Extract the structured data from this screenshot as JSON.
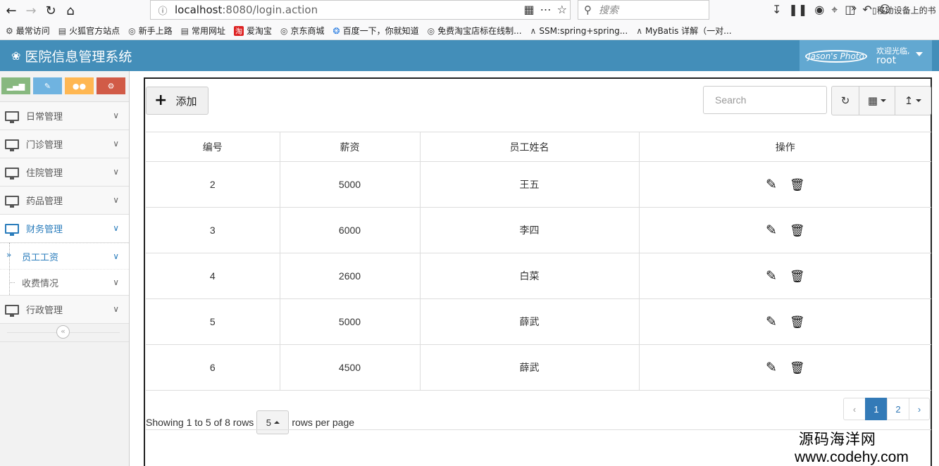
{
  "browser": {
    "url_host": "localhost",
    "url_rest": ":8080/login.action",
    "search_placeholder": "搜索",
    "bookmarks": [
      {
        "label": "最常访问",
        "icon": "gear-icon"
      },
      {
        "label": "火狐官方站点",
        "icon": "folder-icon"
      },
      {
        "label": "新手上路",
        "icon": "globe-icon"
      },
      {
        "label": "常用网址",
        "icon": "folder-icon"
      },
      {
        "label": "爱淘宝",
        "icon": "taobao-icon"
      },
      {
        "label": "京东商城",
        "icon": "globe-icon"
      },
      {
        "label": "百度一下，你就知道",
        "icon": "paw-icon"
      },
      {
        "label": "免费淘宝店标在线制...",
        "icon": "globe-icon"
      },
      {
        "label": "SSM:spring+spring...",
        "icon": "logo-icon"
      },
      {
        "label": "MyBatis 详解（一对...",
        "icon": "logo-icon"
      }
    ],
    "mobile_bookmarks": "移动设备上的书"
  },
  "header": {
    "brand": "医院信息管理系统",
    "photo_alt": "Jason's Photo",
    "welcome": "欢迎光临,",
    "username": "root"
  },
  "sidebar": {
    "menu": [
      {
        "label": "日常管理"
      },
      {
        "label": "门诊管理"
      },
      {
        "label": "住院管理"
      },
      {
        "label": "药品管理"
      },
      {
        "label": "财务管理"
      }
    ],
    "submenu": [
      {
        "label": "员工工资"
      },
      {
        "label": "收费情况"
      }
    ],
    "last_menu": {
      "label": "行政管理"
    }
  },
  "toolbar": {
    "add_label": "添加",
    "search_placeholder": "Search"
  },
  "table": {
    "columns": [
      "编号",
      "薪资",
      "员工姓名",
      "操作"
    ],
    "rows": [
      {
        "id": "2",
        "salary": "5000",
        "name": "王五"
      },
      {
        "id": "3",
        "salary": "6000",
        "name": "李四"
      },
      {
        "id": "4",
        "salary": "2600",
        "name": "白菜"
      },
      {
        "id": "5",
        "salary": "5000",
        "name": "薛武"
      },
      {
        "id": "6",
        "salary": "4500",
        "name": "薛武"
      }
    ]
  },
  "pager": {
    "showing": "Showing 1 to 5 of 8 rows",
    "page_size": "5",
    "per_page": "rows per page",
    "prev": "‹",
    "pages": [
      "1",
      "2"
    ],
    "next": "›",
    "current": "1"
  },
  "watermark": {
    "line1": "源码海洋网",
    "line2": "www.codehy.com"
  }
}
